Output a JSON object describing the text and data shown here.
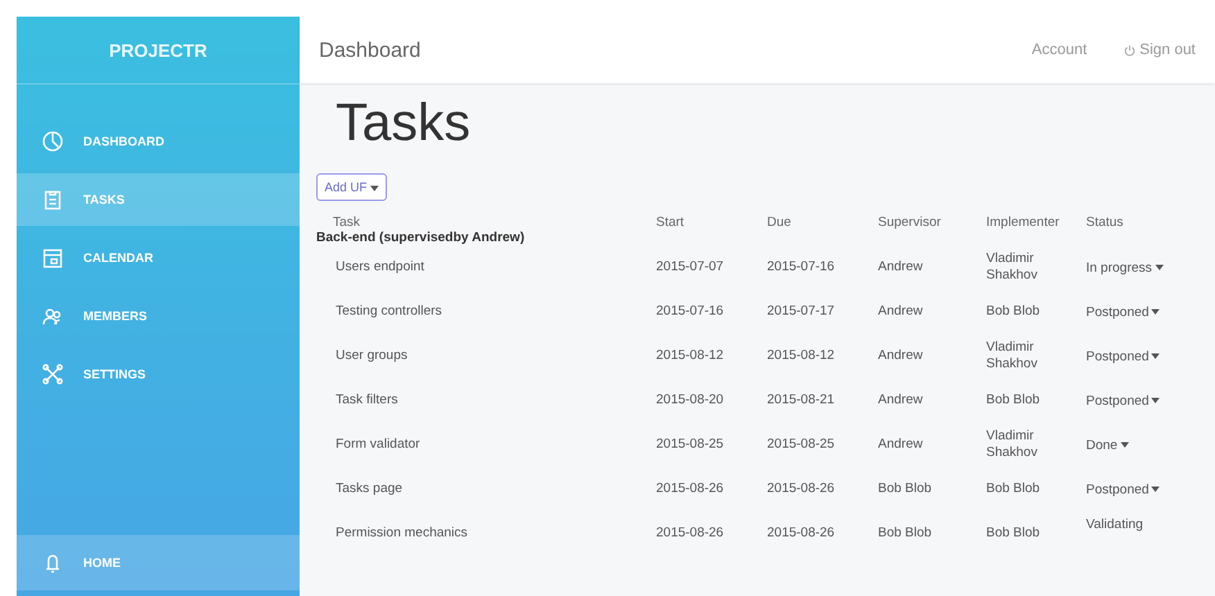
{
  "sidebar": {
    "brand": "PROJECTR",
    "items": [
      {
        "label": "DASHBOARD",
        "selected": false
      },
      {
        "label": "TASKS",
        "selected": true
      },
      {
        "label": "CALENDAR",
        "selected": false
      },
      {
        "label": "MEMBERS",
        "selected": false
      },
      {
        "label": "SETTINGS",
        "selected": false
      }
    ],
    "footer": {
      "label": "HOME"
    }
  },
  "topbar": {
    "title": "Dashboard",
    "links": [
      "Account",
      "Sign out"
    ]
  },
  "page": {
    "title": "Tasks",
    "add_button": "Add UF"
  },
  "table": {
    "columns": [
      "Task",
      "Start",
      "Due",
      "Supervisor",
      "Implementer",
      "Status"
    ],
    "group": "Back-end (supervisedby Andrew)",
    "rows": [
      {
        "task": "Users endpoint",
        "start": "2015-07-07",
        "due": "2015-07-16",
        "supervisor": "Andrew",
        "implementer": "Vladimir Shakhov",
        "status": "In progress",
        "has_menu": true
      },
      {
        "task": "Testing controllers",
        "start": "2015-07-16",
        "due": "2015-07-17",
        "supervisor": "Andrew",
        "implementer": "Bob Blob",
        "status": "Postponed",
        "has_menu": true
      },
      {
        "task": "User groups",
        "start": "2015-08-12",
        "due": "2015-08-12",
        "supervisor": "Andrew",
        "implementer": "Vladimir Shakhov",
        "status": "Postponed",
        "has_menu": true
      },
      {
        "task": "Task filters",
        "start": "2015-08-20",
        "due": "2015-08-21",
        "supervisor": "Andrew",
        "implementer": "Bob Blob",
        "status": "Postponed",
        "has_menu": true
      },
      {
        "task": "Form validator",
        "start": "2015-08-25",
        "due": "2015-08-25",
        "supervisor": "Andrew",
        "implementer": "Vladimir Shakhov",
        "status": "Done",
        "has_menu": true
      },
      {
        "task": "Tasks page",
        "start": "2015-08-26",
        "due": "2015-08-26",
        "supervisor": "Bob Blob",
        "implementer": "Bob Blob",
        "status": "Postponed",
        "has_menu": true
      },
      {
        "task": "Permission mechanics",
        "start": "2015-08-26",
        "due": "2015-08-26",
        "supervisor": "Bob Blob",
        "implementer": "Bob Blob",
        "status": "Validating",
        "has_menu": false
      }
    ]
  }
}
